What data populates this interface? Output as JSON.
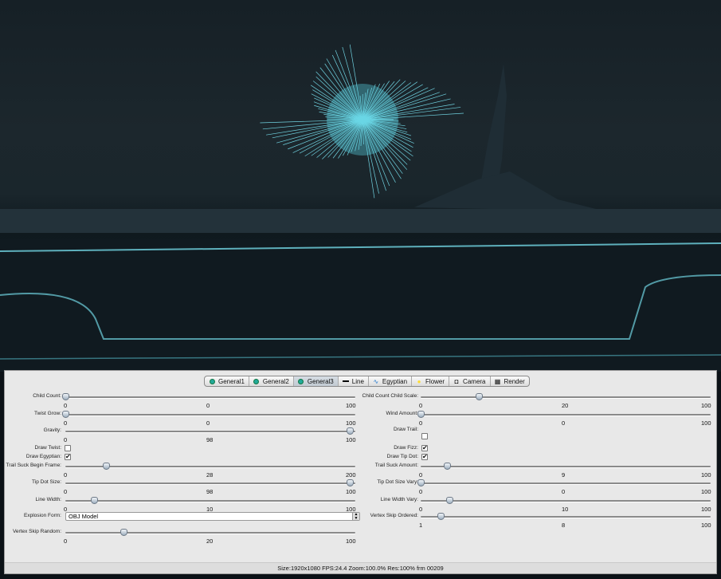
{
  "tabs": [
    {
      "label": "General1",
      "icon": "green-circle-icon",
      "active": false
    },
    {
      "label": "General2",
      "icon": "green-circle-icon",
      "active": false
    },
    {
      "label": "General3",
      "icon": "green-circle-icon",
      "active": true
    },
    {
      "label": "Line",
      "icon": "line-icon",
      "active": false
    },
    {
      "label": "Egyptian",
      "icon": "wave-icon",
      "active": false
    },
    {
      "label": "Flower",
      "icon": "flower-icon",
      "active": false
    },
    {
      "label": "Camera",
      "icon": "camera-icon",
      "active": false
    },
    {
      "label": "Render",
      "icon": "render-icon",
      "active": false
    }
  ],
  "left": [
    {
      "type": "slider",
      "label": "Child Count:",
      "min": "0",
      "value": "0",
      "max": "100",
      "fraction": 0
    },
    {
      "type": "slider",
      "label": "Twist Grow:",
      "min": "0",
      "value": "0",
      "max": "100",
      "fraction": 0
    },
    {
      "type": "slider",
      "label": "Gravity:",
      "min": "0",
      "value": "98",
      "max": "100",
      "fraction": 0.98
    },
    {
      "type": "checkbox",
      "label": "Draw Twist:",
      "checked": false
    },
    {
      "type": "checkbox",
      "label": "Draw Egyptian:",
      "checked": true
    },
    {
      "type": "slider",
      "label": "Trail Suck Begin Frame:",
      "min": "0",
      "value": "28",
      "max": "200",
      "fraction": 0.14
    },
    {
      "type": "slider",
      "label": "Tip Dot Size:",
      "min": "0",
      "value": "98",
      "max": "100",
      "fraction": 0.98
    },
    {
      "type": "slider",
      "label": "Line Width:",
      "min": "0",
      "value": "10",
      "max": "100",
      "fraction": 0.1
    },
    {
      "type": "select",
      "label": "Explosion Form:",
      "value": "OBJ Model"
    },
    {
      "type": "slider",
      "label": "Vertex Skip Random:",
      "min": "0",
      "value": "20",
      "max": "100",
      "fraction": 0.2
    }
  ],
  "right": [
    {
      "type": "slider",
      "label": "Child Count Child Scale:",
      "min": "0",
      "value": "20",
      "max": "100",
      "fraction": 0.2
    },
    {
      "type": "slider",
      "label": "Wind Amount:",
      "min": "0",
      "value": "0",
      "max": "100",
      "fraction": 0
    },
    {
      "type": "checkbox",
      "label": "Draw Trail:",
      "checked": false
    },
    {
      "type": "checkbox",
      "label": "Draw Fizz:",
      "checked": true
    },
    {
      "type": "checkbox",
      "label": "Draw Tip Dot:",
      "checked": true
    },
    {
      "type": "slider",
      "label": "Trail Suck Amount:",
      "min": "0",
      "value": "9",
      "max": "100",
      "fraction": 0.09
    },
    {
      "type": "slider",
      "label": "Tip Dot Size Vary:",
      "min": "0",
      "value": "0",
      "max": "100",
      "fraction": 0
    },
    {
      "type": "slider",
      "label": "Line Width Vary:",
      "min": "0",
      "value": "10",
      "max": "100",
      "fraction": 0.1
    },
    {
      "type": "slider",
      "label": "Vertex Skip Ordered:",
      "min": "1",
      "value": "8",
      "max": "100",
      "fraction": 0.07
    }
  ],
  "status": "Size:1920x1080 FPS:24.4 Zoom:100.0% Res:100%  frm 00209",
  "colors": {
    "glow": "#7ff0ff",
    "panel": "#e8e8e8"
  }
}
